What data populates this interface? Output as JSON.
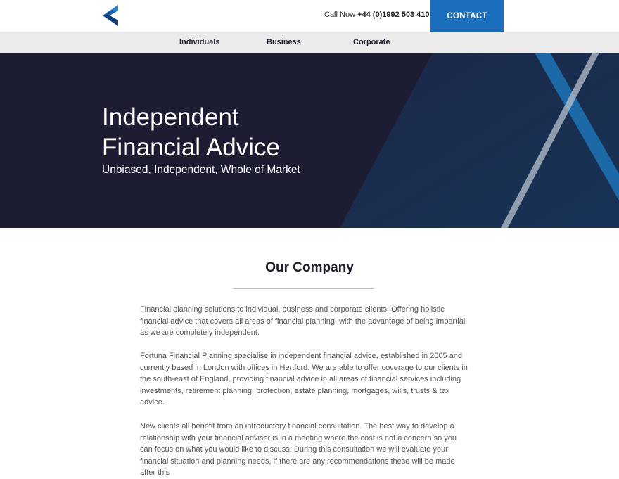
{
  "header": {
    "call_label": "Call Now",
    "phone": "+44 (0)1992 503 410",
    "contact_label": "CONTACT",
    "brand_color": "#1b6fbd"
  },
  "nav": {
    "items": [
      {
        "label": "Individuals"
      },
      {
        "label": "Business"
      },
      {
        "label": "Corporate"
      }
    ]
  },
  "hero": {
    "title_line1": "Independent",
    "title_line2": "Financial Advice",
    "subtitle": "Unbiased, Independent, Whole of Market",
    "bg_color": "#1c1c33",
    "accent_color": "#1e6fb0"
  },
  "company": {
    "title": "Our Company",
    "paragraphs": [
      "Financial planning solutions to individual, business and corporate clients. Offering holistic financial advice that covers all areas of financial planning, with the advantage of being impartial as we are completely independent.",
      "Fortuna Financial Planning specialise in independent financial advice, established in 2005 and currently based in London with offices in Hertford. We are able to offer coverage to our clients in the south-east of England, providing financial advice in all areas of financial services including investments, retirement planning, protection, estate planning, mortgages, wills, trusts & tax advice.",
      "New clients all benefit from an introductory financial consultation. The best way to develop a relationship with your financial adviser is in a meeting where the cost is not a concern so you can focus on what you would like to discuss: During this consultation we will evaluate your financial situation and planning needs, if there are any recommendations these will be made after this"
    ]
  }
}
